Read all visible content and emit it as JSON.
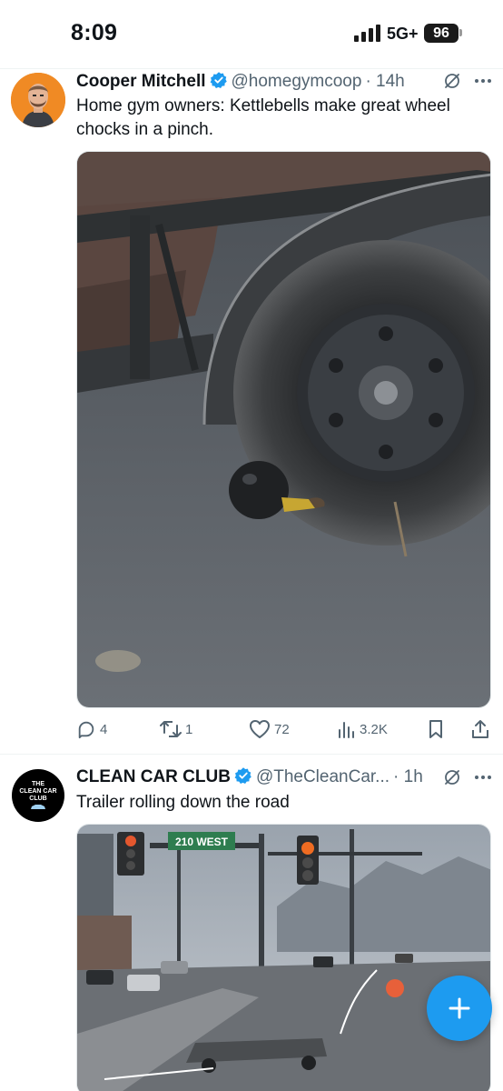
{
  "status_bar": {
    "time": "8:09",
    "network": "5G+",
    "battery": "96"
  },
  "tweets": [
    {
      "display_name": "Cooper Mitchell",
      "handle": "@homegymcoop",
      "time": "· 14h",
      "text": "Home gym owners: Kettlebells make great wheel chocks in a pinch.",
      "stats": {
        "replies": "4",
        "retweets": "1",
        "likes": "72",
        "views": "3.2K"
      }
    },
    {
      "display_name": "CLEAN CAR CLUB",
      "handle": "@TheCleanCar...",
      "time": "· 1h",
      "text": "Trailer rolling down the road",
      "avatar_text": [
        "THE",
        "CLEAN CAR",
        "CLUB"
      ],
      "sign_text": "210 WEST"
    }
  ],
  "colors": {
    "accent": "#1d9bf0",
    "secondary_text": "#536471",
    "divider": "#eff3f4"
  },
  "icons": [
    "signal-icon",
    "verified-badge-icon",
    "grok-icon",
    "more-icon",
    "reply-icon",
    "retweet-icon",
    "like-icon",
    "views-icon",
    "bookmark-icon",
    "share-icon",
    "compose-plus-icon"
  ]
}
